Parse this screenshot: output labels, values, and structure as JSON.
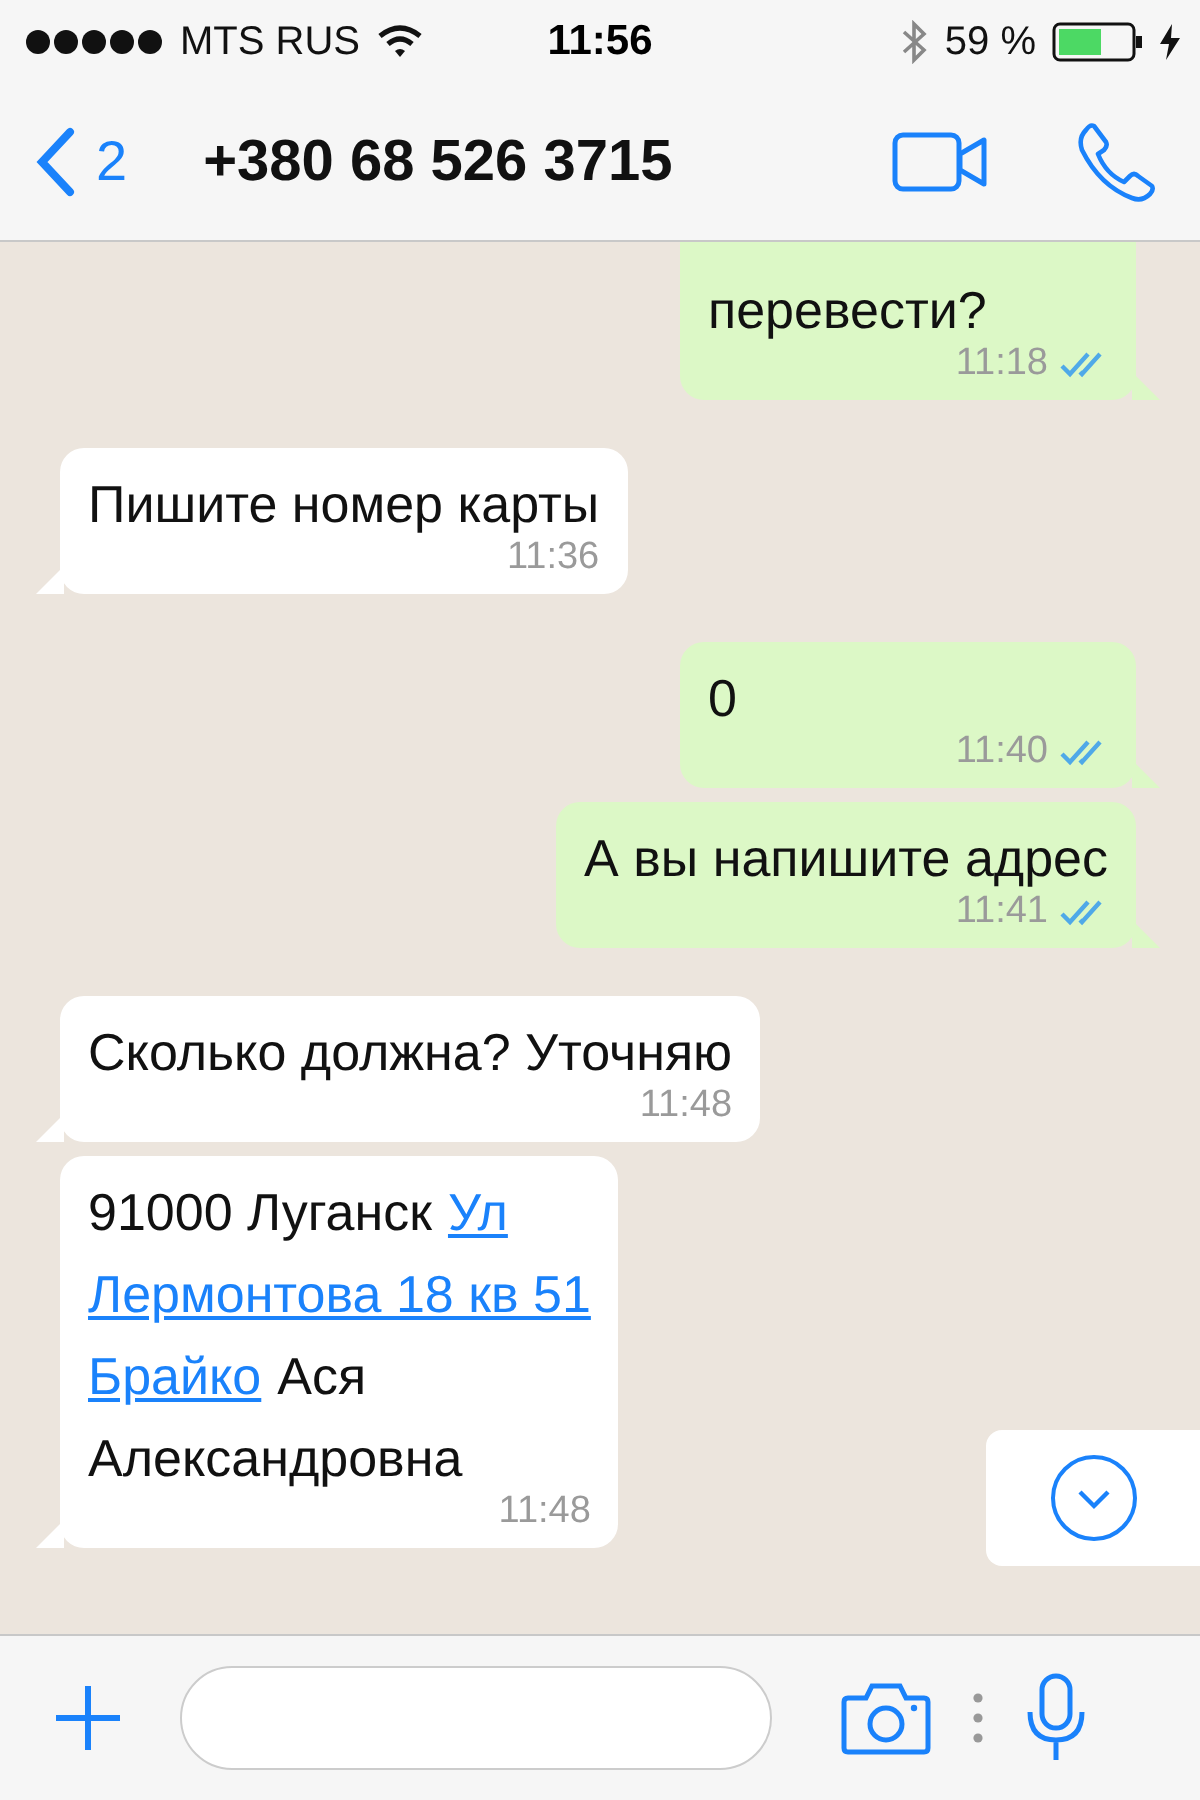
{
  "status_bar": {
    "carrier": "MTS RUS",
    "time": "11:56",
    "battery": "59 %"
  },
  "header": {
    "back_count": "2",
    "title": "+380 68 526 3715"
  },
  "messages": [
    {
      "kind": "outgoing",
      "lines": [
        [
          {
            "kind": "text",
            "text": "перевести?"
          }
        ]
      ],
      "time": "11:18",
      "read": true
    },
    {
      "kind": "incoming",
      "lines": [
        [
          {
            "kind": "text",
            "text": "Пишите номер карты"
          }
        ]
      ],
      "time": "11:36"
    },
    {
      "kind": "outgoing",
      "lines": [
        [
          {
            "kind": "text",
            "text": "0"
          }
        ]
      ],
      "time": "11:40",
      "read": true
    },
    {
      "kind": "outgoing",
      "lines": [
        [
          {
            "kind": "text",
            "text": "А вы напишите адрес"
          }
        ]
      ],
      "time": "11:41",
      "read": true
    },
    {
      "kind": "incoming",
      "lines": [
        [
          {
            "kind": "text",
            "text": "Сколько должна? Уточняю"
          }
        ]
      ],
      "time": "11:48"
    },
    {
      "kind": "incoming",
      "lines": [
        [
          {
            "kind": "text",
            "text": "91000 Луганск"
          },
          {
            "kind": "link",
            "text": "Ул"
          }
        ],
        [
          {
            "kind": "link",
            "text": "Лермонтова 18 кв 51"
          }
        ],
        [
          {
            "kind": "link",
            "text": "Брайко"
          },
          {
            "kind": "text",
            "text": "Ася"
          }
        ],
        [
          {
            "kind": "text",
            "text": "Александровна"
          }
        ]
      ],
      "time": "11:48"
    }
  ],
  "composer": {
    "scroll_down_button": true
  }
}
